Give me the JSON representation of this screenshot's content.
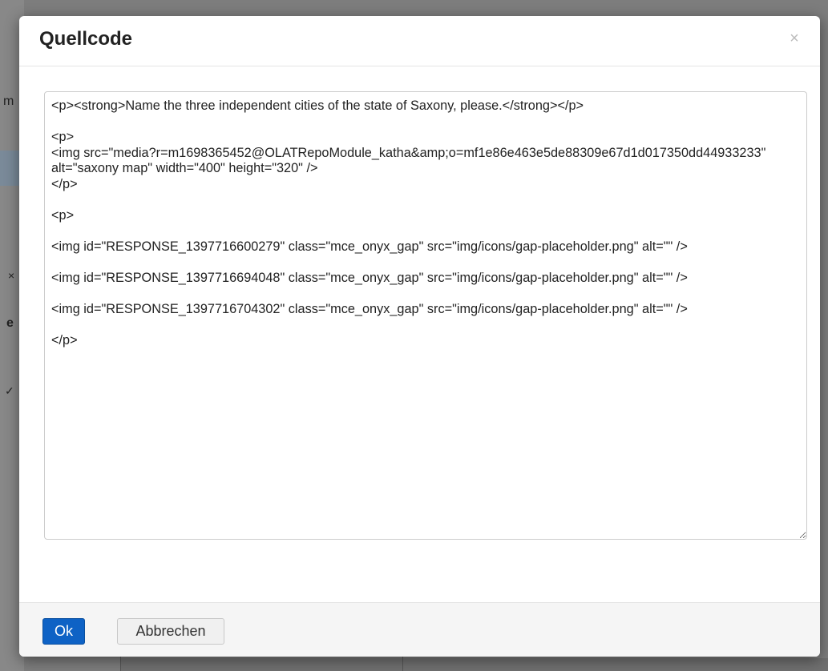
{
  "background": {
    "glyphs": [
      "m",
      "×",
      "e",
      "✓"
    ]
  },
  "dialog": {
    "title": "Quellcode",
    "close_label": "×",
    "source_code": "<p><strong>Name the three independent cities of the state of Saxony, please.</strong></p>\n\n<p>\n<img src=\"media?r=m1698365452@OLATRepoModule_katha&amp;o=mf1e86e463e5de88309e67d1d017350dd44933233\" alt=\"saxony map\" width=\"400\" height=\"320\" />\n</p>\n\n<p>\n\n<img id=\"RESPONSE_1397716600279\" class=\"mce_onyx_gap\" src=\"img/icons/gap-placeholder.png\" alt=\"\" />\n\n<img id=\"RESPONSE_1397716694048\" class=\"mce_onyx_gap\" src=\"img/icons/gap-placeholder.png\" alt=\"\" />\n\n<img id=\"RESPONSE_1397716704302\" class=\"mce_onyx_gap\" src=\"img/icons/gap-placeholder.png\" alt=\"\" />\n\n</p>",
    "ok_label": "Ok",
    "cancel_label": "Abbrechen"
  },
  "colors": {
    "primary_button": "#0e62c5",
    "overlay": "#7d7d7d"
  }
}
